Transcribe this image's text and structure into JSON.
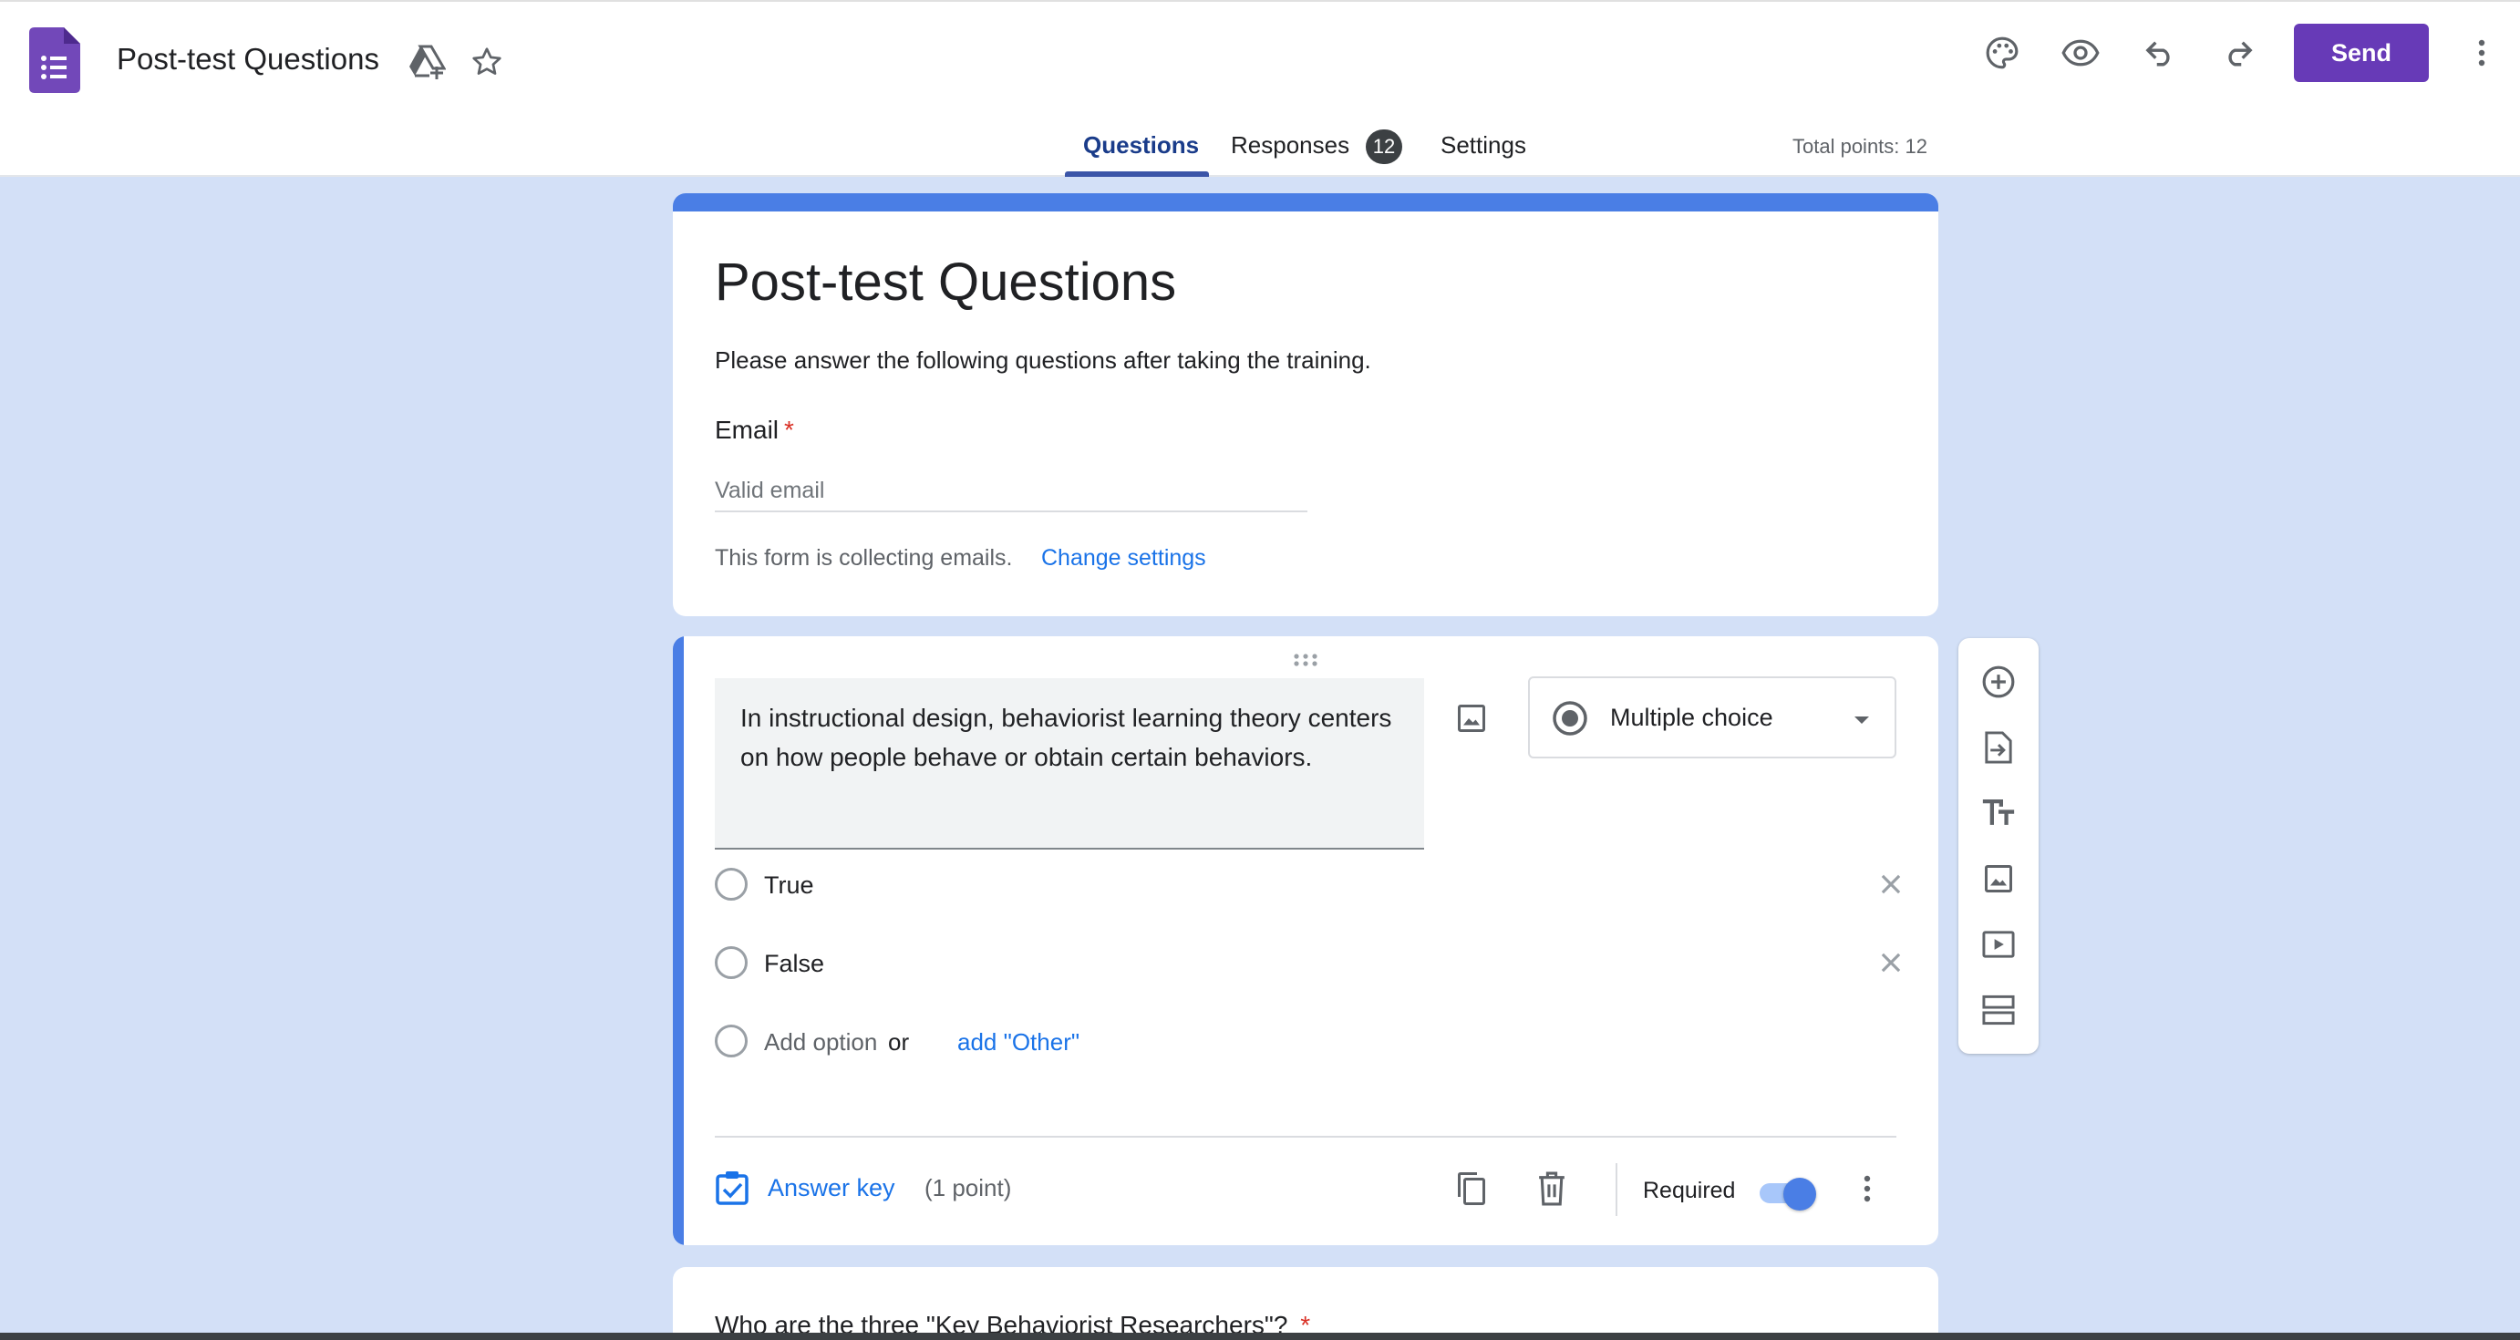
{
  "header": {
    "doc_title": "Post-test Questions",
    "send_label": "Send",
    "brand_color": "#673ab7",
    "icons": [
      "forms-logo-icon",
      "drive-icon",
      "star-icon",
      "palette-icon",
      "preview-icon",
      "undo-icon",
      "redo-icon",
      "more-vert-icon"
    ]
  },
  "tabs": [
    {
      "label": "Questions",
      "active": true
    },
    {
      "label": "Responses",
      "badge": "12"
    },
    {
      "label": "Settings"
    }
  ],
  "total_points": "Total points: 12",
  "form": {
    "title": "Post-test Questions",
    "description": "Please answer the following questions after taking the training.",
    "email_label": "Email",
    "required_mark": "*",
    "email_placeholder": "Valid email",
    "collect_note": "This form is collecting emails.",
    "change_settings": "Change settings",
    "accent_color": "#4a7ee5"
  },
  "question": {
    "text": "In instructional design, behaviorist learning theory centers on how people behave or obtain certain behaviors.",
    "type": "Multiple choice",
    "options": [
      "True",
      "False"
    ],
    "add_option": "Add option",
    "or": "or",
    "add_other": "add \"Other\"",
    "answer_key": "Answer key",
    "points": "(1 point)",
    "required_label": "Required",
    "required": true
  },
  "toolbar": {
    "items": [
      "add-question-icon",
      "import-questions-icon",
      "add-title-icon",
      "add-image-icon",
      "add-video-icon",
      "add-section-icon"
    ]
  },
  "next_question": {
    "text": "Who are the three \"Key Behaviorist Researchers\"?",
    "required_mark": "*"
  }
}
